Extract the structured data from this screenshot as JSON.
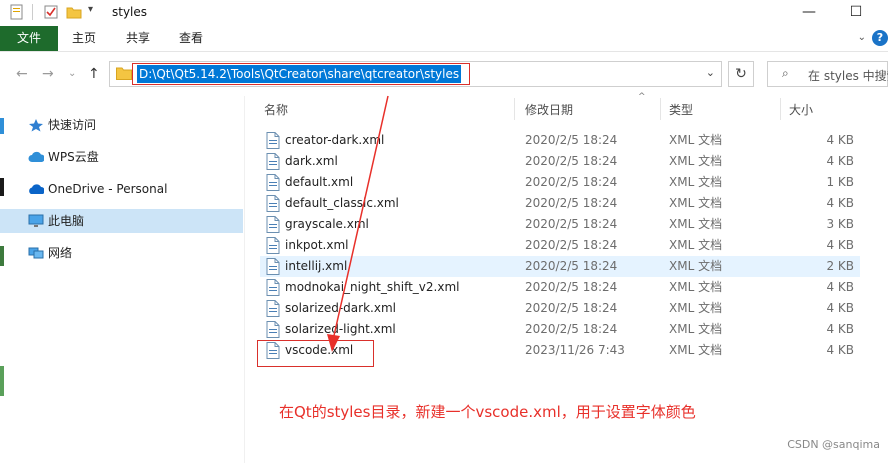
{
  "window": {
    "title": "styles",
    "controls": {
      "minimize": "—",
      "maximize": "☐"
    }
  },
  "ribbon": {
    "tabs": [
      "文件",
      "主页",
      "共享",
      "查看"
    ],
    "help": "?"
  },
  "address_bar": {
    "path": "D:\\Qt\\Qt5.14.2\\Tools\\QtCreator\\share\\qtcreator\\styles",
    "search_placeholder": "在 styles 中搜索"
  },
  "sidebar": {
    "items": [
      {
        "label": "快速访问",
        "icon": "star-icon"
      },
      {
        "label": "WPS云盘",
        "icon": "cloud-icon"
      },
      {
        "label": "OneDrive - Personal",
        "icon": "onedrive-icon"
      },
      {
        "label": "此电脑",
        "icon": "computer-icon",
        "selected": true
      },
      {
        "label": "网络",
        "icon": "network-icon"
      }
    ]
  },
  "columns": {
    "name": "名称",
    "date": "修改日期",
    "type": "类型",
    "size": "大小"
  },
  "files": [
    {
      "name": "creator-dark.xml",
      "date": "2020/2/5 18:24",
      "type": "XML 文档",
      "size": "4 KB"
    },
    {
      "name": "dark.xml",
      "date": "2020/2/5 18:24",
      "type": "XML 文档",
      "size": "4 KB"
    },
    {
      "name": "default.xml",
      "date": "2020/2/5 18:24",
      "type": "XML 文档",
      "size": "1 KB"
    },
    {
      "name": "default_classic.xml",
      "date": "2020/2/5 18:24",
      "type": "XML 文档",
      "size": "4 KB"
    },
    {
      "name": "grayscale.xml",
      "date": "2020/2/5 18:24",
      "type": "XML 文档",
      "size": "3 KB"
    },
    {
      "name": "inkpot.xml",
      "date": "2020/2/5 18:24",
      "type": "XML 文档",
      "size": "4 KB"
    },
    {
      "name": "intellij.xml",
      "date": "2020/2/5 18:24",
      "type": "XML 文档",
      "size": "2 KB",
      "highlighted": true
    },
    {
      "name": "modnokai_night_shift_v2.xml",
      "date": "2020/2/5 18:24",
      "type": "XML 文档",
      "size": "4 KB"
    },
    {
      "name": "solarized-dark.xml",
      "date": "2020/2/5 18:24",
      "type": "XML 文档",
      "size": "4 KB"
    },
    {
      "name": "solarized-light.xml",
      "date": "2020/2/5 18:24",
      "type": "XML 文档",
      "size": "4 KB"
    },
    {
      "name": "vscode.xml",
      "date": "2023/11/26 7:43",
      "type": "XML 文档",
      "size": "4 KB"
    }
  ],
  "annotation": "在Qt的styles目录，新建一个vscode.xml，用于设置字体颜色",
  "watermark": "CSDN @sanqima",
  "colors": {
    "file_tab": "#1e6b2c",
    "selection": "#0078d7",
    "annotation_red": "#e8302a"
  }
}
